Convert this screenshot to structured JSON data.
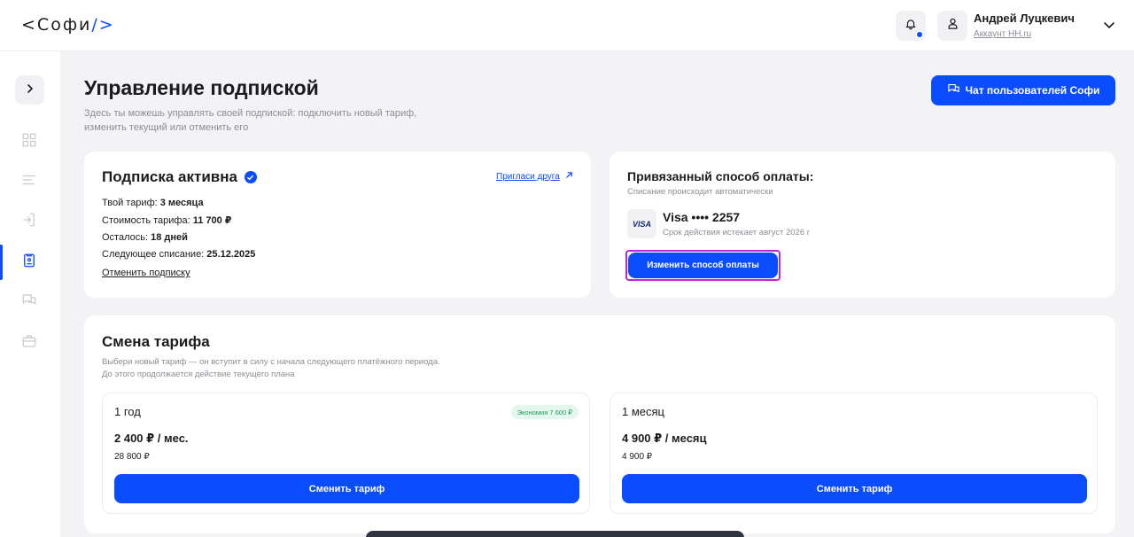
{
  "header": {
    "logo_open": "<",
    "logo_text": "Софи",
    "logo_close": "/>",
    "user_name": "Андрей Луцкевич",
    "user_account": "Аккаунт HH.ru"
  },
  "page": {
    "title": "Управление подпиской",
    "description": "Здесь ты можешь управлять своей подпиской: подключить новый тариф, изменить текущий или отменить его",
    "chat_button": "Чат пользователей Софи"
  },
  "subscription": {
    "title": "Подписка активна",
    "invite_link": "Пригласи друга",
    "tariff_label": "Твой тариф: ",
    "tariff_value": "3 месяца",
    "cost_label": "Стоимость тарифа: ",
    "cost_value": "11 700 ₽",
    "left_label": "Осталось: ",
    "left_value": "18 дней",
    "next_label": "Следующее списание: ",
    "next_value": "25.12.2025",
    "cancel_link": "Отменить подписку"
  },
  "payment": {
    "title": "Привязанный способ оплаты:",
    "note": "Списание происходит автоматически",
    "brand": "VISA",
    "card_number": "Visa •••• 2257",
    "expiry": "Срок действия истекает август 2026 г",
    "change_button": "Изменить способ оплаты"
  },
  "change_plan": {
    "title": "Смена тарифа",
    "description_line1": "Выбери новый тариф — он вступит в силу с начала следующего платёжного периода.",
    "description_line2": "До этого продолжается действие текущего плана",
    "plans": [
      {
        "name": "1 год",
        "badge": "Экономия 7 600 ₽",
        "price": "2 400 ₽ / мес.",
        "total": "28 800 ₽",
        "button": "Сменить тариф"
      },
      {
        "name": "1 месяц",
        "price": "4 900 ₽ / месяц",
        "total": "4 900 ₽",
        "button": "Сменить тариф"
      }
    ]
  },
  "colors": {
    "accent": "#0a4cff",
    "highlight_border": "#c026d3",
    "badge_bg": "#e4f7ee",
    "badge_text": "#1f9d5b"
  },
  "icons": {
    "sidebar": [
      "chevron-right-icon",
      "dashboard-icon",
      "list-icon",
      "login-icon",
      "document-icon",
      "chat-icon",
      "briefcase-icon"
    ]
  }
}
